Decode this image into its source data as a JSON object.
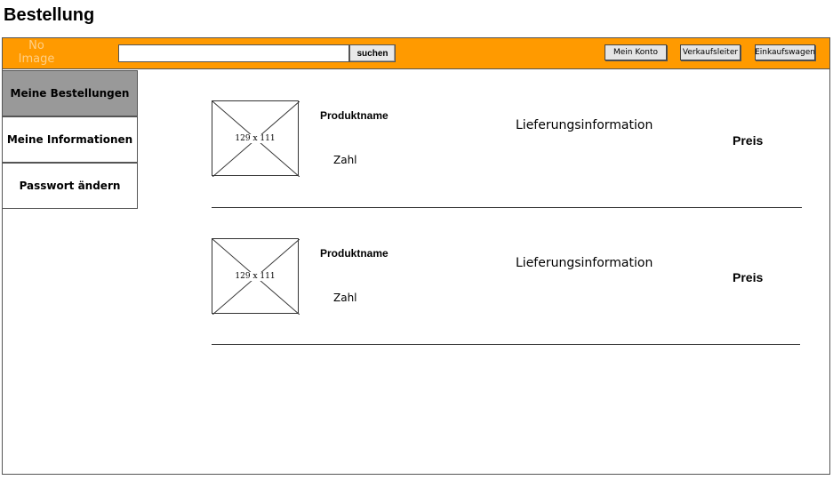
{
  "page": {
    "title": "Bestellung"
  },
  "header": {
    "logo_text": "No Image",
    "search": {
      "value": "",
      "placeholder": "",
      "button_label": "suchen"
    },
    "nav": {
      "account": "Mein Konto",
      "sales": "Verkaufsleiter",
      "cart": "Einkaufswagen"
    },
    "colors": {
      "bar": "#ff9a00"
    }
  },
  "sidebar": {
    "items": [
      {
        "label": "Meine Bestellungen",
        "active": true
      },
      {
        "label": "Meine Informationen",
        "active": false
      },
      {
        "label": "Passwort ändern",
        "active": false
      }
    ]
  },
  "orders": [
    {
      "image_label": "129 x 111",
      "product_name": "Produktname",
      "quantity": "Zahl",
      "delivery": "Lieferungsinformation",
      "price": "Preis"
    },
    {
      "image_label": "129 x 111",
      "product_name": "Produktname",
      "quantity": "Zahl",
      "delivery": "Lieferungsinformation",
      "price": "Preis"
    }
  ]
}
